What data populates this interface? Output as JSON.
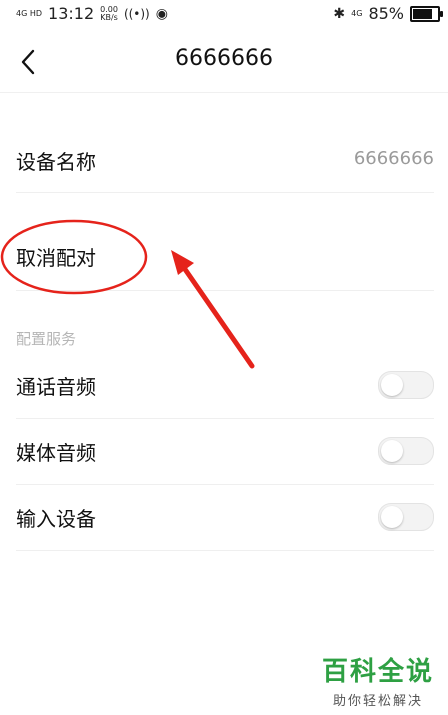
{
  "status_bar": {
    "network": "4G HD",
    "time": "13:12",
    "speed_value": "0.00",
    "speed_unit": "KB/s",
    "signal_right": "4G",
    "battery": "85%",
    "battery_level": 0.85
  },
  "nav": {
    "title": "6666666"
  },
  "device": {
    "name_label": "设备名称",
    "name_value": "6666666",
    "unpair_label": "取消配对"
  },
  "services": {
    "title": "配置服务",
    "items": [
      {
        "label": "通话音频",
        "enabled": false
      },
      {
        "label": "媒体音频",
        "enabled": false
      },
      {
        "label": "输入设备",
        "enabled": false
      }
    ]
  },
  "annotation": {
    "color": "#e5231b"
  },
  "watermark": {
    "title": "百科全说",
    "subtitle": "助你轻松解决"
  }
}
